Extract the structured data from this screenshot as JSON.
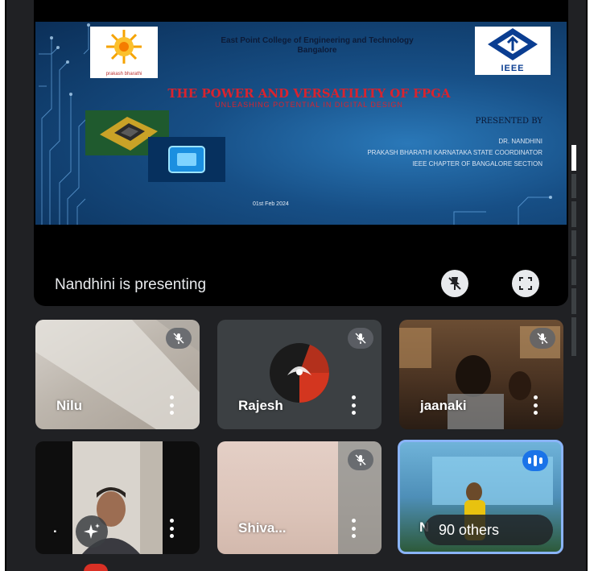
{
  "presentation": {
    "slide": {
      "college_line1": "East Point College of Engineering and Technology",
      "college_line2": "Bangalore",
      "left_logo_caption": "prakash bharathi",
      "right_logo_caption": "IEEE",
      "title": "THE POWER AND VERSATILITY OF FPGA",
      "subtitle": "UNLEASHING POTENTIAL IN DIGITAL DESIGN",
      "presented_by": "PRESENTED BY",
      "presenter_name": "DR. NANDHINI",
      "presenter_role": "PRAKASH BHARATHI KARNATAKA STATE COORDINATOR",
      "presenter_org": "IEEE CHAPTER OF BANGALORE SECTION",
      "date": "01st Feb 2024"
    },
    "presenting_label": "Nandhini is presenting",
    "unpin_icon": "pin-off-icon",
    "fullscreen_icon": "fullscreen-icon"
  },
  "participants": [
    {
      "name": "Nilu",
      "muted": true
    },
    {
      "name": "Rajesh",
      "muted": true
    },
    {
      "name": "jaanaki",
      "muted": true
    },
    {
      "name": ".",
      "muted": false,
      "effects_icon": "sparkle-icon"
    },
    {
      "name": "Shiva...",
      "muted": true
    },
    {
      "name": "N",
      "others_label": "90 others",
      "speaking": true
    }
  ],
  "colors": {
    "background": "#202124",
    "tile": "#3c4043",
    "accent": "#1a73e8",
    "slide_title": "#d9232e"
  }
}
